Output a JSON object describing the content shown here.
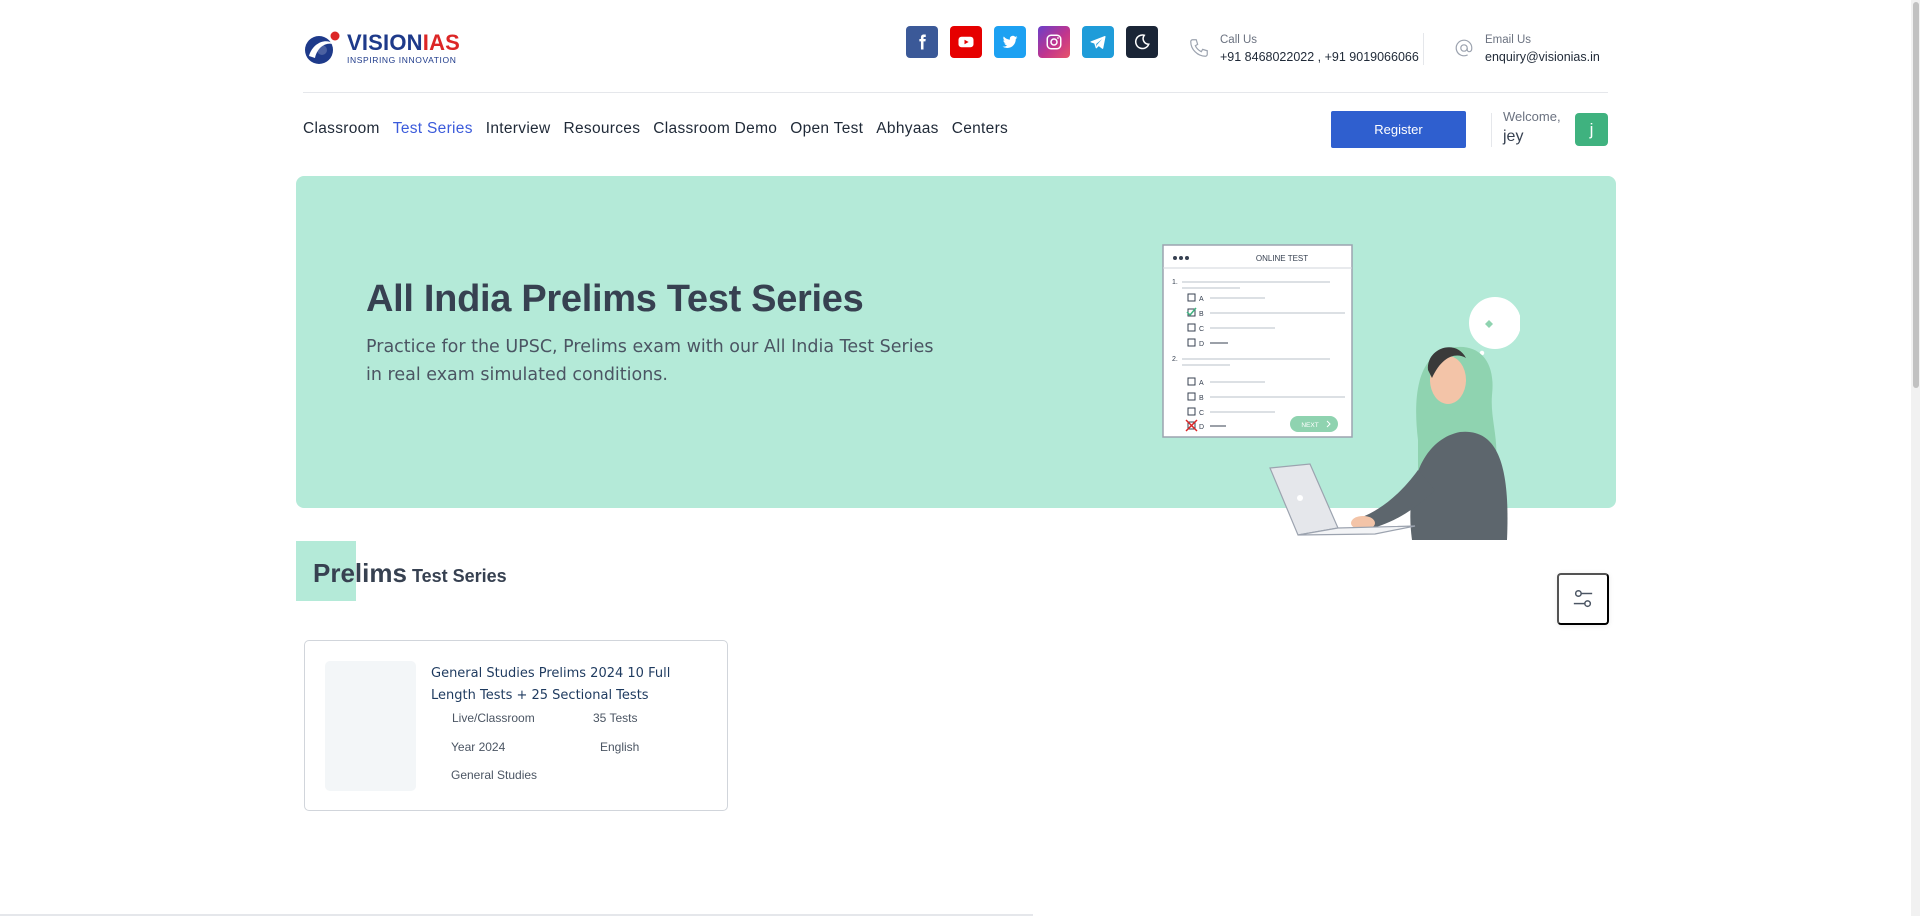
{
  "brand": {
    "name_part1": "VISION",
    "name_part2": "IAS",
    "tagline": "INSPIRING INNOVATION"
  },
  "social": [
    {
      "name": "facebook-icon"
    },
    {
      "name": "youtube-icon"
    },
    {
      "name": "twitter-icon"
    },
    {
      "name": "instagram-icon"
    },
    {
      "name": "telegram-icon"
    },
    {
      "name": "dark-mode-icon"
    }
  ],
  "contact": {
    "call_label": "Call Us",
    "call_value": "+91 8468022022 , +91 9019066066",
    "email_label": "Email Us",
    "email_value": "enquiry@visionias.in"
  },
  "nav": {
    "items": [
      "Classroom",
      "Test Series",
      "Interview",
      "Resources",
      "Classroom Demo",
      "Open Test",
      "Abhyaas",
      "Centers"
    ],
    "active": "Test Series"
  },
  "user": {
    "register_label": "Register",
    "welcome_label": "Welcome,",
    "name": "jey",
    "avatar_initial": "j"
  },
  "hero": {
    "title": "All India Prelims Test Series",
    "subtitle": "Practice for the UPSC, Prelims exam with our All India Test Series in real exam simulated conditions.",
    "illustration": {
      "header": "ONLINE TEST",
      "q1": "1.",
      "q2": "2.",
      "options": [
        "A",
        "B",
        "C",
        "D"
      ],
      "next_label": "NEXT"
    }
  },
  "section": {
    "title_main": "Prelims",
    "title_rest": "Test Series"
  },
  "cards": [
    {
      "title": "General Studies Prelims 2024 10 Full Length Tests + 25 Sectional Tests",
      "mode": "Live/Classroom",
      "tests": "35 Tests",
      "year": "Year 2024",
      "language": "English",
      "subject": "General Studies"
    }
  ],
  "colors": {
    "hero_bg": "#b4ead8",
    "register_bg": "#2f5fcf",
    "nav_active": "#3b5bdb",
    "avatar_bg": "#3fb27f"
  }
}
